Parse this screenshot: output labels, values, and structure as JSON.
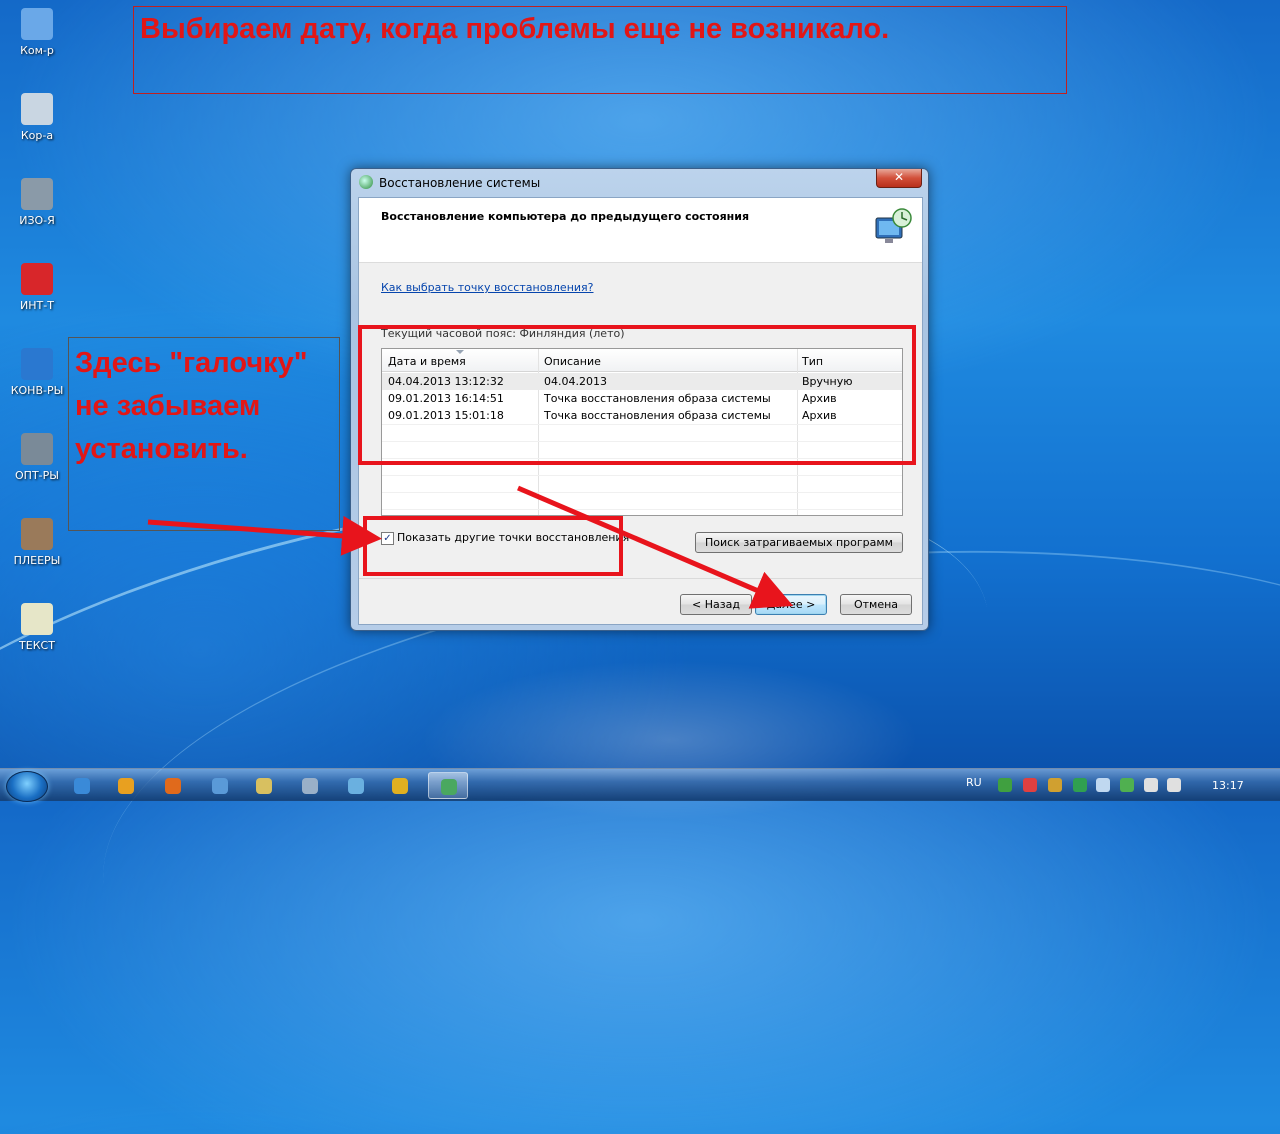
{
  "annotation": {
    "title": "Выбираем дату, когда проблемы еще не возникало.",
    "note": "Здесь \"галочку\" не забываем установить."
  },
  "desktop_icons": [
    {
      "label": "Ком-р",
      "icon": "computer-icon",
      "color": "#6aa8e8"
    },
    {
      "label": "Кор-а",
      "icon": "recycle-bin-icon",
      "color": "#c9d6e2"
    },
    {
      "label": "ИЗО-Я",
      "icon": "brush-icon",
      "color": "#8a9aa8"
    },
    {
      "label": "ИНТ-Т",
      "icon": "opera-icon",
      "color": "#d8262a"
    },
    {
      "label": "КОНВ-РЫ",
      "icon": "converter-icon",
      "color": "#2a78d0"
    },
    {
      "label": "ОПТ-РЫ",
      "icon": "tools-icon",
      "color": "#7a8a98"
    },
    {
      "label": "ПЛЕЕРЫ",
      "icon": "player-icon",
      "color": "#9a7a5a"
    },
    {
      "label": "ТЕКСТ",
      "icon": "notepad-icon",
      "color": "#e6e6c8"
    }
  ],
  "window": {
    "title": "Восстановление системы",
    "close": "✕",
    "heading": "Восстановление компьютера до предыдущего состояния",
    "help_link": "Как выбрать точку восстановления?",
    "timezone": "Текущий часовой пояс: Финляндия (лето)",
    "columns": [
      "Дата и время",
      "Описание",
      "Тип"
    ],
    "rows": [
      {
        "date": "04.04.2013 13:12:32",
        "desc": "04.04.2013",
        "type": "Вручную"
      },
      {
        "date": "09.01.2013 16:14:51",
        "desc": "Точка восстановления образа системы",
        "type": "Архив"
      },
      {
        "date": "09.01.2013 15:01:18",
        "desc": "Точка восстановления образа системы",
        "type": "Архив"
      }
    ],
    "show_more_label": "Показать другие точки восстановления",
    "show_more_checked": true,
    "scan_button": "Поиск затрагиваемых программ",
    "back_button": "< Назад",
    "next_button": "Далее >",
    "cancel_button": "Отмена"
  },
  "taskbar": {
    "items": [
      {
        "icon": "media-player-icon",
        "color": "#3a8ad8"
      },
      {
        "icon": "avast-icon",
        "color": "#e8a020"
      },
      {
        "icon": "firefox-icon",
        "color": "#e06a1c"
      },
      {
        "icon": "remote-desktop-icon",
        "color": "#5a9ad8"
      },
      {
        "icon": "paint-icon",
        "color": "#d8c060"
      },
      {
        "icon": "monitor-icon",
        "color": "#9ab0c8"
      },
      {
        "icon": "network-icon",
        "color": "#6ab0e0"
      },
      {
        "icon": "chrome-icon",
        "color": "#e0b020"
      },
      {
        "icon": "system-restore-icon",
        "color": "#4aa860"
      }
    ],
    "language": "RU",
    "tray_icons": [
      {
        "icon": "tray-app-icon",
        "color": "#40a040"
      },
      {
        "icon": "tray-flag-icon",
        "color": "#e04040"
      },
      {
        "icon": "tray-grid-icon",
        "color": "#d0a030"
      },
      {
        "icon": "tray-shield-icon",
        "color": "#30a050"
      },
      {
        "icon": "tray-search-icon",
        "color": "#c0d8f0"
      },
      {
        "icon": "tray-update-icon",
        "color": "#50b050"
      },
      {
        "icon": "tray-network-icon",
        "color": "#e0e0e0"
      },
      {
        "icon": "volume-icon",
        "color": "#e0e0e0"
      }
    ],
    "clock": "13:17"
  }
}
